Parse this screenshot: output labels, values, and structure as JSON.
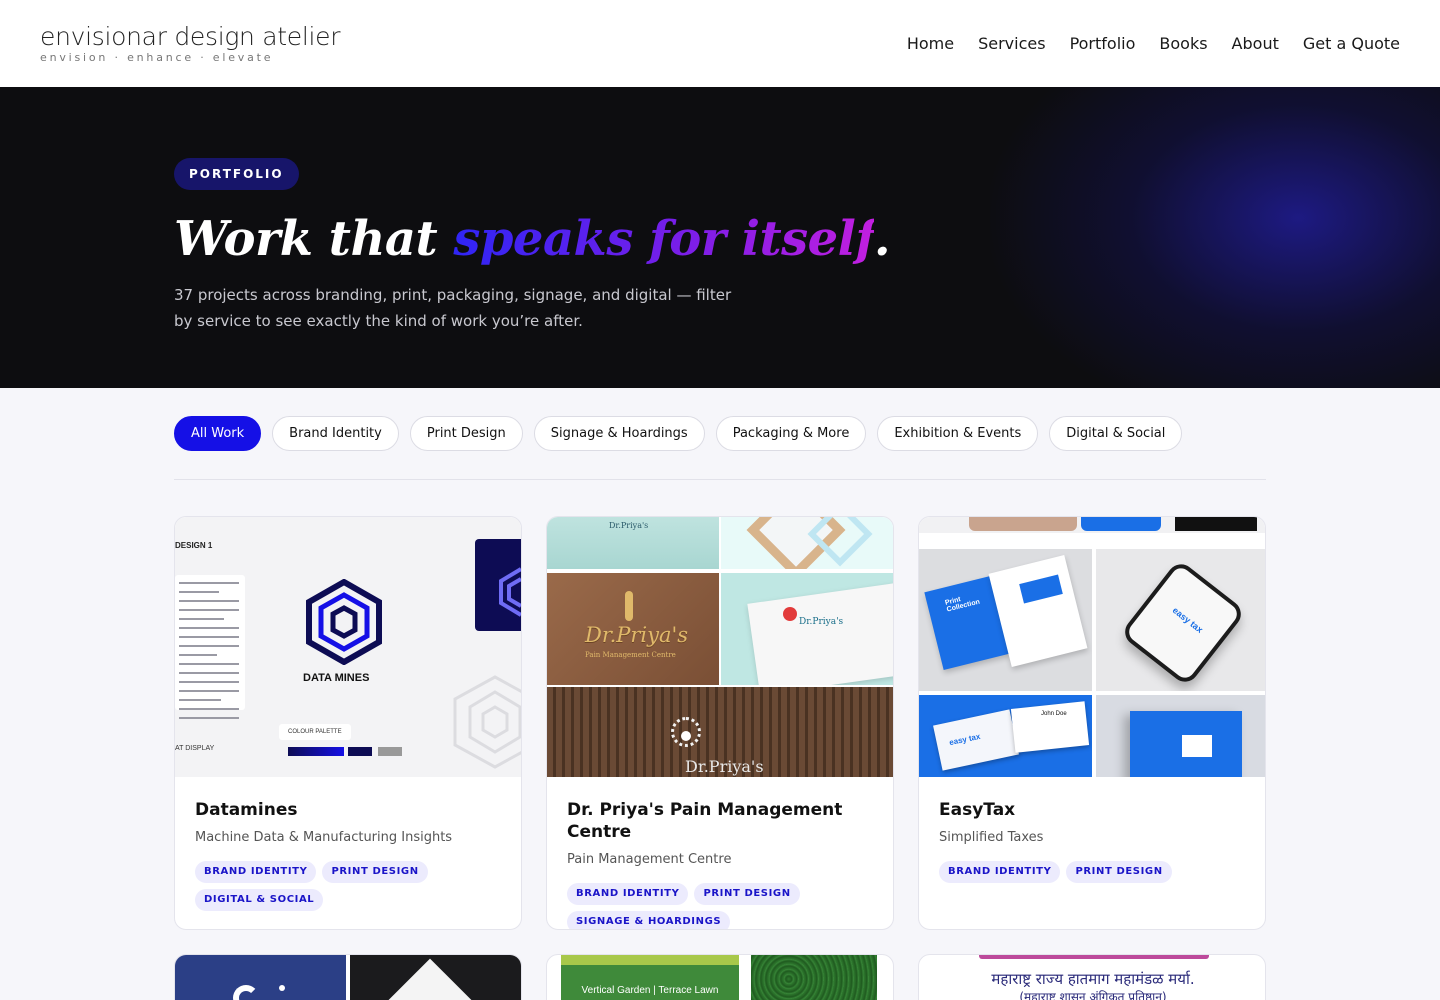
{
  "header": {
    "logo_name": "envisionar design atelier",
    "logo_tagline": "envision · enhance · elevate",
    "nav": [
      "Home",
      "Services",
      "Portfolio",
      "Books",
      "About",
      "Get a Quote"
    ]
  },
  "hero": {
    "badge": "PORTFOLIO",
    "title_start": "Work that ",
    "title_highlight": "speaks for itself",
    "title_end": ".",
    "subtitle": "37 projects across branding, print, packaging, signage, and digital — filter by service to see exactly the kind of work you’re after."
  },
  "filters": {
    "items": [
      "All Work",
      "Brand Identity",
      "Print Design",
      "Signage & Hoardings",
      "Packaging & More",
      "Exhibition & Events",
      "Digital & Social"
    ],
    "active": "All Work"
  },
  "projects": [
    {
      "title": "Datamines",
      "subtitle": "Machine Data & Manufacturing Insights",
      "tags": [
        "BRAND IDENTITY",
        "PRINT DESIGN",
        "DIGITAL & SOCIAL"
      ],
      "image": {
        "label": "DESIGN 1",
        "brand_name": "DATA MINES",
        "palette_label": "COLOUR PALETTE",
        "footer": "AT DISPLAY",
        "palette_colors": [
          "#0d0c54",
          "#1510e6",
          "#0d0c54",
          "#999999"
        ]
      }
    },
    {
      "title": "Dr. Priya's Pain Management Centre",
      "subtitle": "Pain Management Centre",
      "tags": [
        "BRAND IDENTITY",
        "PRINT DESIGN",
        "SIGNAGE & HOARDINGS"
      ],
      "image": {
        "brand_name": "Dr.Priya's",
        "brand_sub": "Pain Management Centre",
        "shirt_text": "Dr.Priya's"
      }
    },
    {
      "title": "EasyTax",
      "subtitle": "Simplified Taxes",
      "tags": [
        "BRAND IDENTITY",
        "PRINT DESIGN"
      ],
      "image": {
        "brochure_text": "Print Collection",
        "logo_text": "easy tax",
        "card_name": "John Doe"
      }
    }
  ],
  "row2": {
    "card2_text": "Vertical Garden | Terrace Lawn",
    "card3_text": "महाराष्ट्र राज्य हातमाग महामंडळ मर्या.",
    "card3_sub": "(महाराष्ट्र शासन अंगिकृत प्रतिष्ठान)"
  },
  "colors": {
    "accent": "#1510e6",
    "tag_bg": "#ecebfd",
    "hero_bg": "#0d0d10"
  }
}
